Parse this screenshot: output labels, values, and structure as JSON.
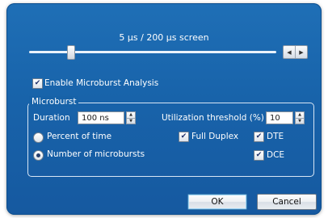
{
  "scale": {
    "label": "5 µs / 200 µs screen",
    "slider_value": 0.17
  },
  "stepper_arrows": {
    "left": "◀",
    "right": "▶"
  },
  "enable_checkbox": {
    "label": "Enable Microburst Analysis",
    "checked": true,
    "mark": "✔"
  },
  "group": {
    "title": "Microburst",
    "duration_label": "Duration",
    "duration_value": "100 ns",
    "threshold_label": "Utilization threshold (%)",
    "threshold_value": "10",
    "spin_up": "▲",
    "spin_down": "▼",
    "radio_percent_label": "Percent of time",
    "radio_number_label": "Number of microbursts",
    "selected_radio": "Number of microbursts",
    "full_duplex_label": "Full Duplex",
    "full_duplex_checked": true,
    "dte_label": "DTE",
    "dte_checked": true,
    "dce_label": "DCE",
    "dce_checked": true,
    "check_mark": "✔"
  },
  "buttons": {
    "ok": "OK",
    "cancel": "Cancel"
  },
  "colors": {
    "dialog_bg": "#1a66ad",
    "text": "#ffffff"
  }
}
